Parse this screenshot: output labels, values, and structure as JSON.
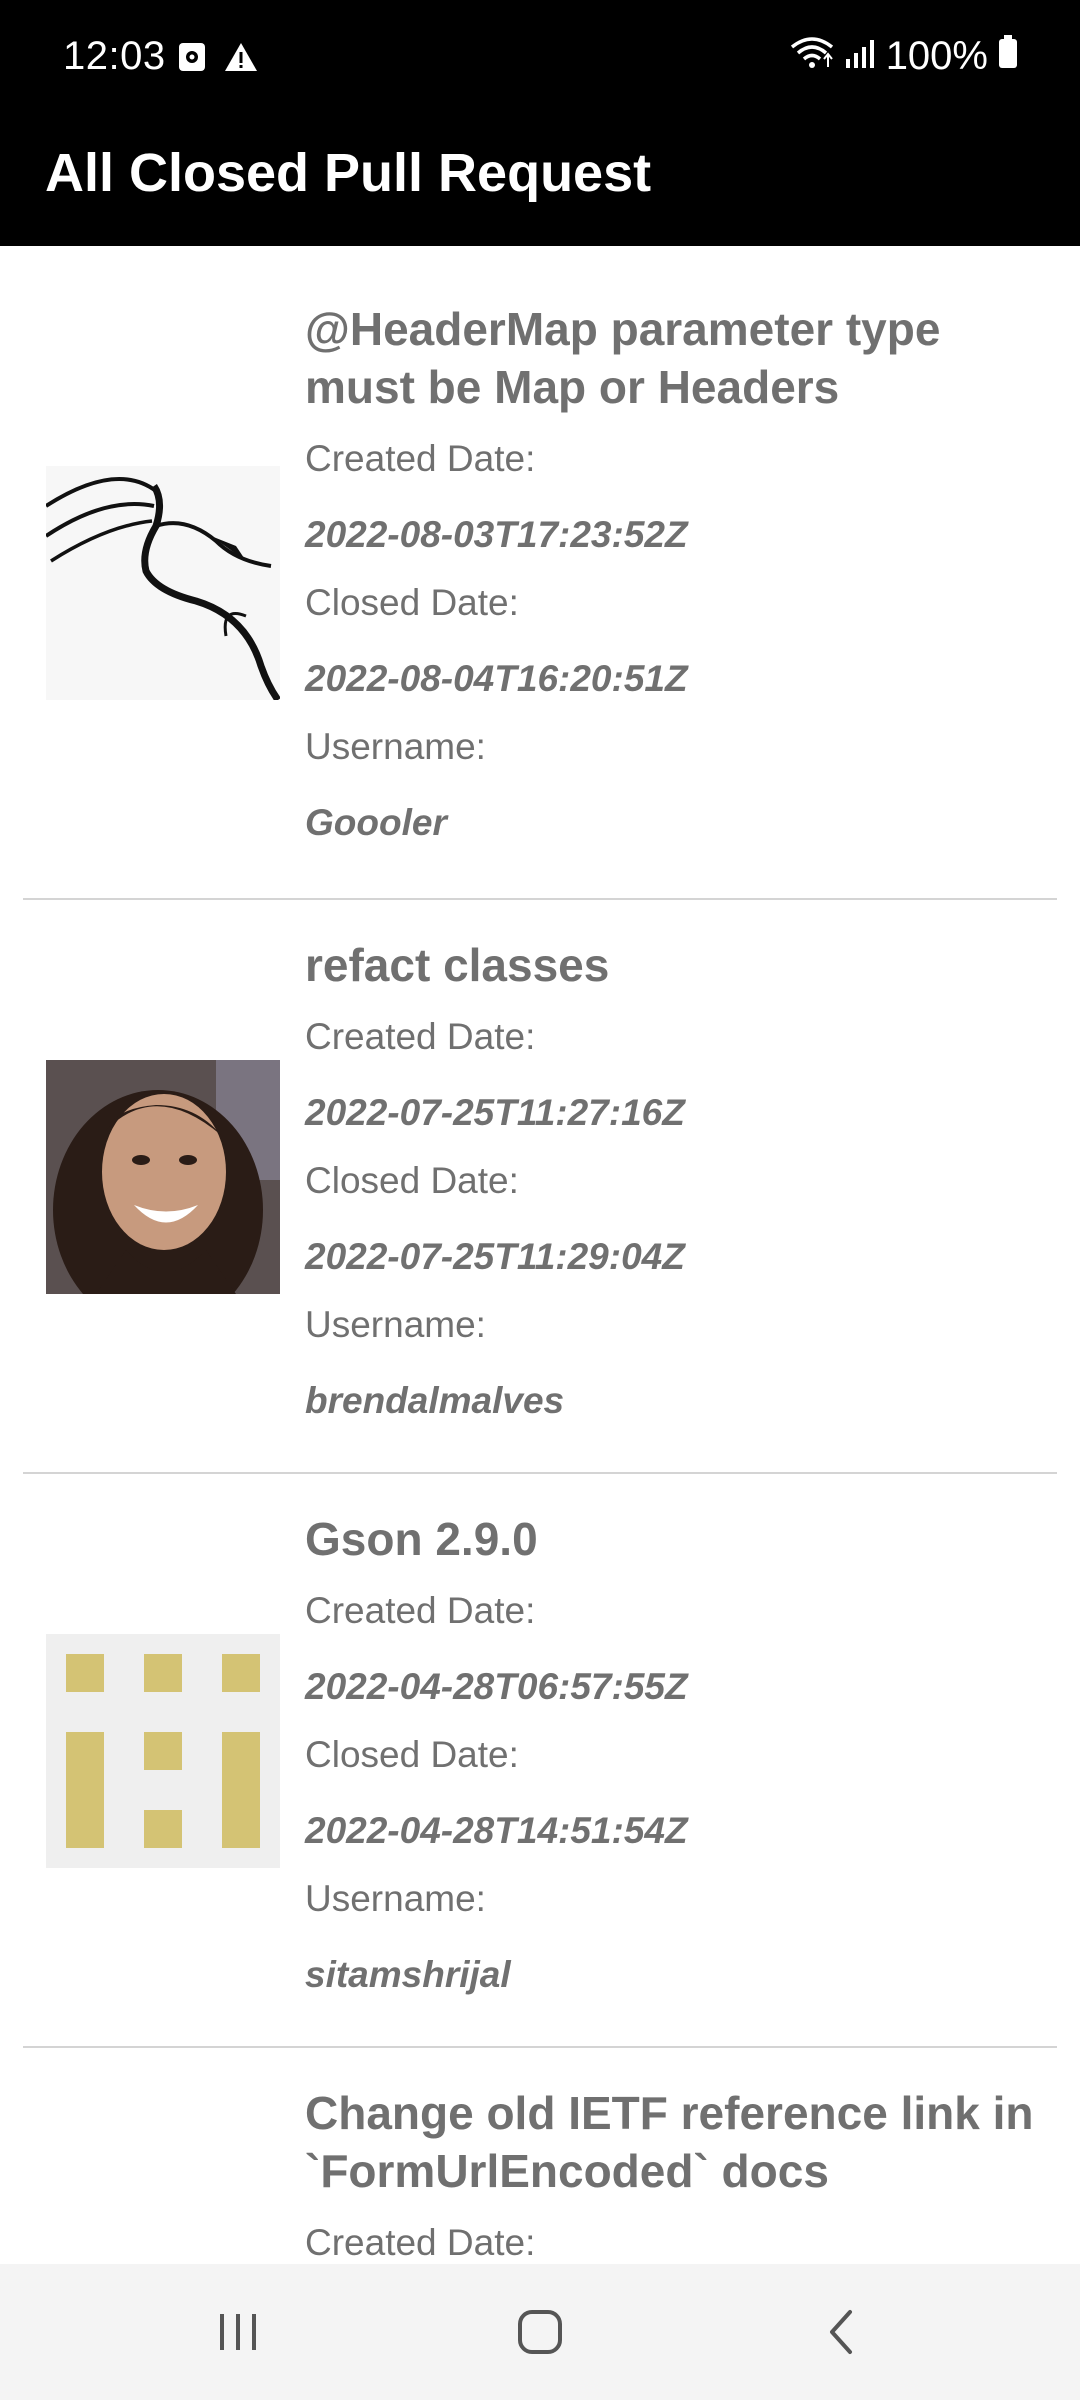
{
  "status_bar": {
    "time": "12:03",
    "battery": "100%",
    "icons": [
      "screen-record-icon",
      "alert-icon",
      "wifi-icon",
      "signal-icon",
      "battery-icon"
    ]
  },
  "app_bar": {
    "title": "All Closed Pull Request"
  },
  "pull_requests": [
    {
      "title": "@HeaderMap parameter type must be Map or Headers",
      "created_label": "Created Date:",
      "created_date": "2022-08-03T17:23:52Z",
      "closed_label": "Closed Date:",
      "closed_date": "2022-08-04T16:20:51Z",
      "username_label": "Username:",
      "username": "Goooler",
      "avatar": "dragon-logo-avatar"
    },
    {
      "title": "refact classes",
      "created_label": "Created Date:",
      "created_date": "2022-07-25T11:27:16Z",
      "closed_label": "Closed Date:",
      "closed_date": "2022-07-25T11:29:04Z",
      "username_label": "Username:",
      "username": "brendalmalves",
      "avatar": "person-photo-avatar"
    },
    {
      "title": "Gson 2.9.0",
      "created_label": "Created Date:",
      "created_date": "2022-04-28T06:57:55Z",
      "closed_label": "Closed Date:",
      "closed_date": "2022-04-28T14:51:54Z",
      "username_label": "Username:",
      "username": "sitamshrijal",
      "avatar": "identicon-avatar"
    },
    {
      "title": "Change old IETF reference link in `FormUrlEncoded` docs",
      "created_label": "Created Date:"
    }
  ],
  "nav_bar": {
    "buttons": [
      "recent-apps-icon",
      "home-icon",
      "back-icon"
    ]
  },
  "colors": {
    "bar_background": "#000000",
    "text_gray": "#707070",
    "divider": "#d4d4d4",
    "identicon_fill": "#d4c374",
    "identicon_bg": "#efefef",
    "nav_background": "#f4f4f4"
  }
}
